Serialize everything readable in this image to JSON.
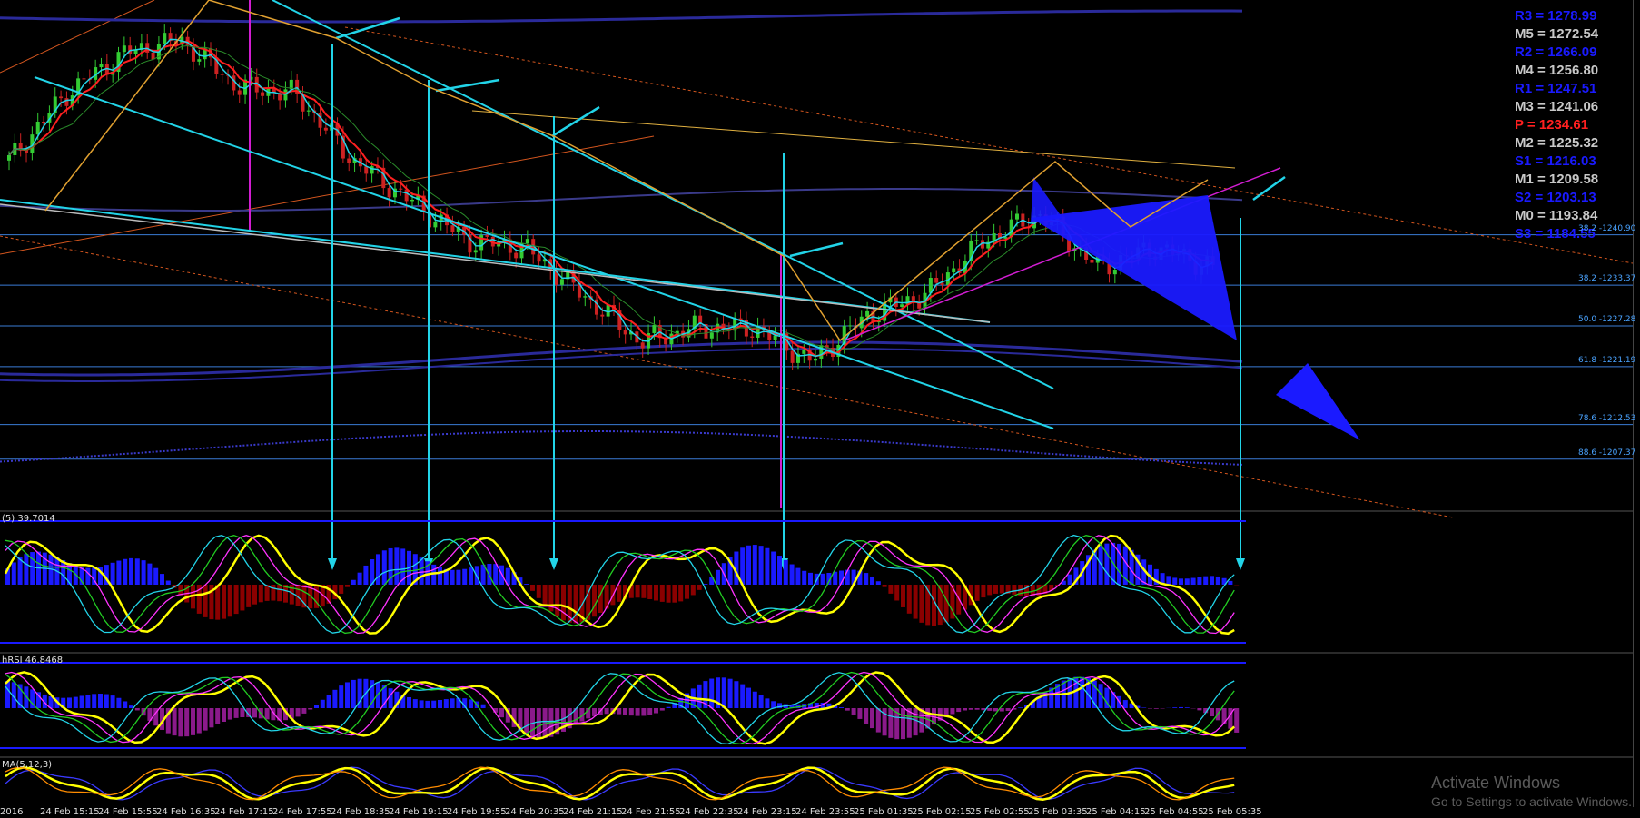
{
  "chart_data": {
    "type": "line",
    "panels": [
      {
        "name": "price",
        "indicator_label": "",
        "kind": "candlestick"
      },
      {
        "name": "oscillator-1",
        "indicator_label": "(5) 39.7014",
        "kind": "histogram+lines"
      },
      {
        "name": "oscillator-2",
        "indicator_label": "hRSI 46.8468",
        "kind": "histogram+lines"
      },
      {
        "name": "oscillator-3",
        "indicator_label": "MA(5,12,3)",
        "kind": "lines"
      }
    ],
    "pivot_levels": [
      {
        "label": "R3 = 1278.99",
        "value": 1278.99,
        "color": "#1a1aff"
      },
      {
        "label": "M5 = 1272.54",
        "value": 1272.54,
        "color": "#c8c8c8"
      },
      {
        "label": "R2 = 1266.09",
        "value": 1266.09,
        "color": "#1a1aff"
      },
      {
        "label": "M4 = 1256.80",
        "value": 1256.8,
        "color": "#c8c8c8"
      },
      {
        "label": "R1 = 1247.51",
        "value": 1247.51,
        "color": "#1a1aff"
      },
      {
        "label": "M3 = 1241.06",
        "value": 1241.06,
        "color": "#c8c8c8"
      },
      {
        "label": "P  = 1234.61",
        "value": 1234.61,
        "color": "#ff2020"
      },
      {
        "label": "M2 = 1225.32",
        "value": 1225.32,
        "color": "#c8c8c8"
      },
      {
        "label": "S1 = 1216.03",
        "value": 1216.03,
        "color": "#1a1aff"
      },
      {
        "label": "M1 = 1209.58",
        "value": 1209.58,
        "color": "#c8c8c8"
      },
      {
        "label": "S2 = 1203.13",
        "value": 1203.13,
        "color": "#1a1aff"
      },
      {
        "label": "M0 = 1193.84",
        "value": 1193.84,
        "color": "#c8c8c8"
      },
      {
        "label": "S3 = 1184.55",
        "value": 1184.55,
        "color": "#1a1aff"
      }
    ],
    "fib_levels": [
      {
        "label": "38.2 -1240.90",
        "value": 1240.9
      },
      {
        "label": "38.2 -1233.37",
        "value": 1233.37
      },
      {
        "label": "50.0 -1227.28",
        "value": 1227.28
      },
      {
        "label": "61.8 -1221.19",
        "value": 1221.19
      },
      {
        "label": "78.6 -1212.53",
        "value": 1212.53
      },
      {
        "label": "88.6 -1207.37",
        "value": 1207.37
      }
    ],
    "x_categories": [
      "2016",
      "24 Feb 15:15",
      "24 Feb 15:55",
      "24 Feb 16:35",
      "24 Feb 17:15",
      "24 Feb 17:55",
      "24 Feb 18:35",
      "24 Feb 19:15",
      "24 Feb 19:55",
      "24 Feb 20:35",
      "24 Feb 21:15",
      "24 Feb 21:55",
      "24 Feb 22:35",
      "24 Feb 23:15",
      "24 Feb 23:55",
      "25 Feb 01:35",
      "25 Feb 02:15",
      "25 Feb 02:55",
      "25 Feb 03:35",
      "25 Feb 04:15",
      "25 Feb 04:55",
      "25 Feb 05:35"
    ],
    "close": [
      1252,
      1262,
      1268,
      1270,
      1263,
      1262,
      1252,
      1246,
      1240,
      1239,
      1232,
      1225,
      1227,
      1227,
      1222,
      1229,
      1232,
      1240,
      1244,
      1236,
      1239,
      1236
    ],
    "colors": {
      "background": "#000000",
      "candle_up": "#33cc33",
      "candle_down": "#cc2222",
      "trendline": "#22d4e8",
      "hist_pos": "#1a1aff",
      "hist_neg": "#8b0000",
      "hist_neg_2": "#8b1a8b",
      "signal_yellow": "#ffff00",
      "pivot_blue": "#1a1aff",
      "pivot_red": "#ff2020",
      "pivot_gray": "#c8c8c8"
    }
  },
  "watermark": {
    "title": "Activate Windows",
    "subtitle": "Go to Settings to activate Windows."
  }
}
